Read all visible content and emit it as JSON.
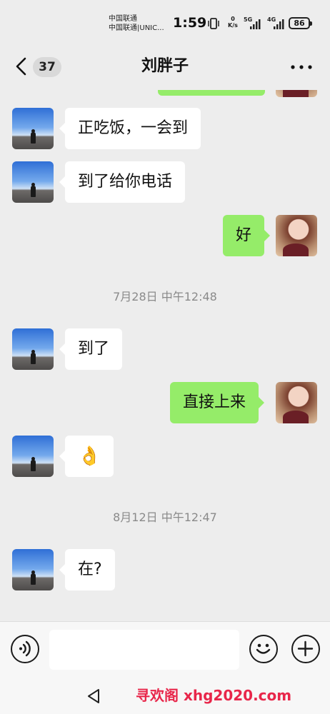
{
  "status_bar": {
    "carrier_1": "中国联通",
    "carrier_2": "中国联通|UNIC...",
    "time": "1:59",
    "net_speed_value": "0",
    "net_speed_unit": "K/s",
    "signal_1": "5G",
    "signal_2": "4G",
    "battery": "86"
  },
  "nav": {
    "unread_count": "37",
    "title": "刘胖子"
  },
  "messages": [
    {
      "side": "in",
      "text": "正吃饭，一会到"
    },
    {
      "side": "in",
      "text": "到了给你电话"
    },
    {
      "side": "out",
      "text": "好"
    },
    {
      "type": "time",
      "text": "7月28日 中午12:48"
    },
    {
      "side": "in",
      "text": "到了"
    },
    {
      "side": "out",
      "text": "直接上来"
    },
    {
      "side": "in",
      "text": "👌"
    },
    {
      "type": "time",
      "text": "8月12日 中午12:47"
    },
    {
      "side": "in",
      "text": "在?"
    }
  ],
  "input": {
    "value": ""
  },
  "watermark": "寻欢阁 xhg2020.com"
}
